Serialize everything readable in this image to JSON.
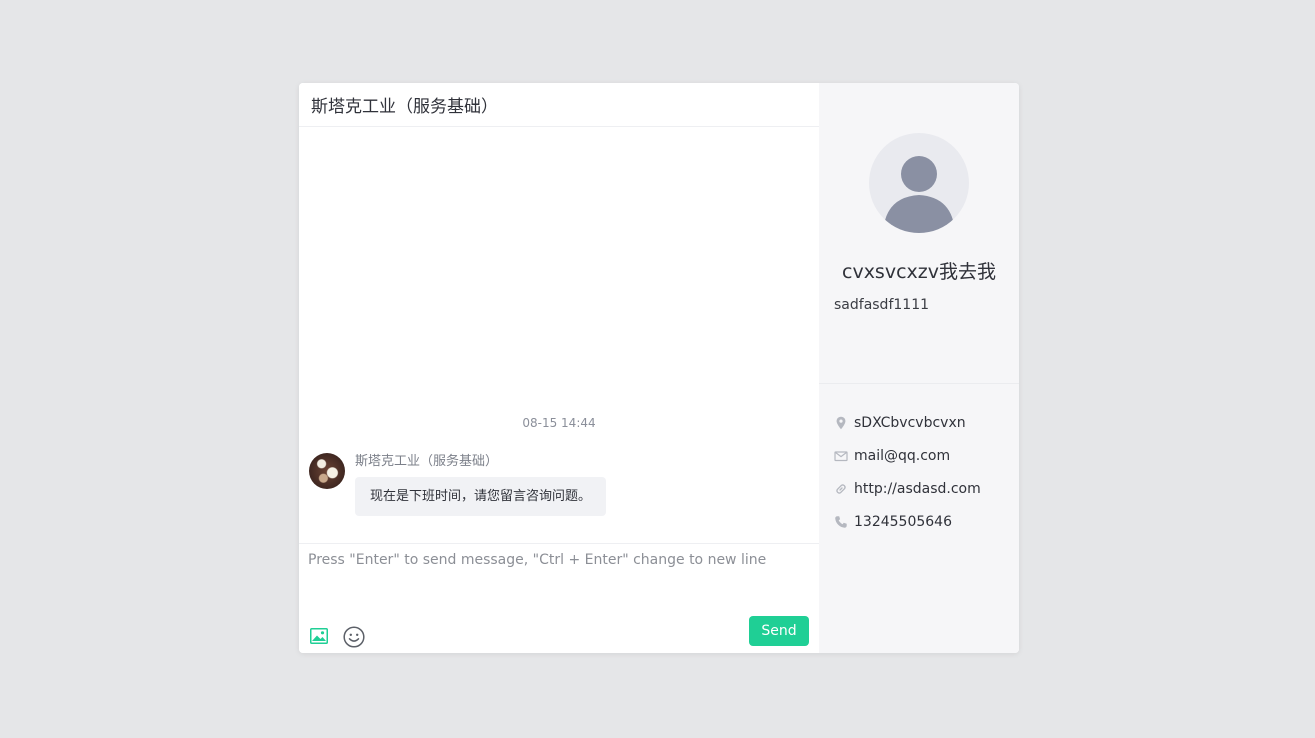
{
  "chat": {
    "title": "斯塔克工业（服务基础）",
    "timestamp": "08-15 14:44",
    "messages": [
      {
        "sender": "斯塔克工业（服务基础）",
        "text": "现在是下班时间，请您留言咨询问题。"
      }
    ],
    "composer": {
      "placeholder": "Press \"Enter\" to send message, \"Ctrl + Enter\" change to new line",
      "send_label": "Send"
    }
  },
  "profile": {
    "name": "cvxsvcxzv我去我",
    "subtitle": "sadfasdf1111",
    "info": {
      "location": "sDXCbvcvbcvxn",
      "email": "mail@qq.com",
      "website": "http://asdasd.com",
      "phone": "13245505646"
    }
  },
  "icons": {
    "image": "image-icon",
    "emoji": "emoji-icon",
    "location": "location-pin-icon",
    "email": "mail-icon",
    "website": "link-icon",
    "phone": "phone-icon"
  },
  "colors": {
    "accent": "#1fcf95",
    "background": "#e5e6e8",
    "profile_background": "#f6f6f8",
    "bubble": "#f1f2f5"
  }
}
